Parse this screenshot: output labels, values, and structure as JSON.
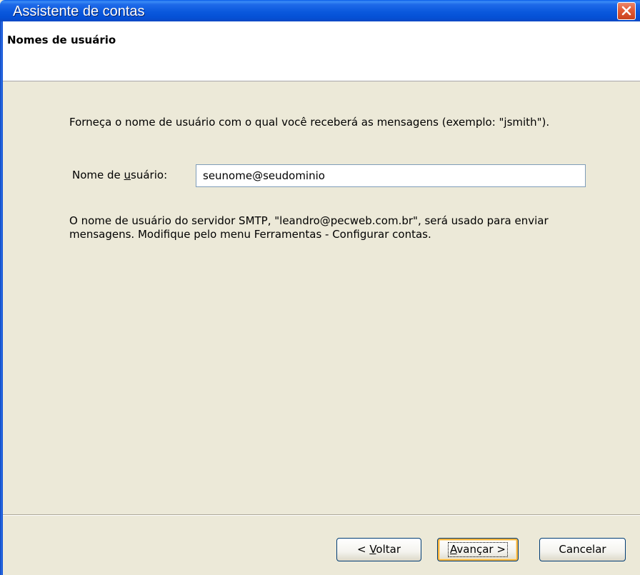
{
  "window": {
    "title": "Assistente de contas",
    "close_icon": "close-icon",
    "accent_color": "#0A58DD",
    "close_color": "#E15A35"
  },
  "header": {
    "title": "Nomes de usuário"
  },
  "main": {
    "intro_text": "Forneça o nome de usuário com o qual você receberá as mensagens (exemplo: \"jsmith\").",
    "username_label_prefix": "Nome de ",
    "username_label_mnemonic": "u",
    "username_label_suffix": "suário:",
    "username_value": "seunome@seudominio",
    "smtp_note": "O nome de usuário do servidor SMTP, \"leandro@pecweb.com.br\", será usado para enviar mensagens. Modifique pelo menu Ferramentas - Configurar contas."
  },
  "buttons": {
    "back_prefix": "< ",
    "back_mnemonic": "V",
    "back_suffix": "oltar",
    "next_mnemonic": "A",
    "next_suffix": "vançar >",
    "cancel_label": "Cancelar"
  }
}
